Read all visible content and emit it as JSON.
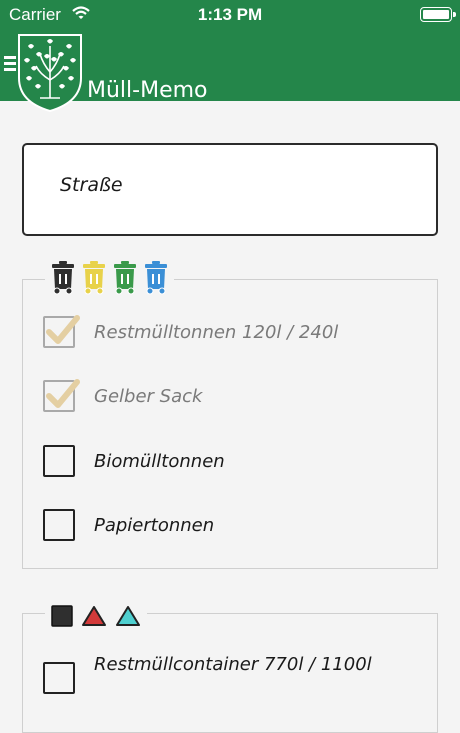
{
  "status": {
    "carrier": "Carrier",
    "time": "1:13 PM"
  },
  "header": {
    "title": "Müll-Memo"
  },
  "search": {
    "placeholder": "Straße"
  },
  "groups": [
    {
      "bin_icons": [
        "trash-bin-black-icon",
        "trash-bin-yellow-icon",
        "trash-bin-green-icon",
        "trash-bin-blue-icon"
      ],
      "items": [
        {
          "label": "Restmülltonnen 120l / 240l",
          "checked": true
        },
        {
          "label": "Gelber Sack",
          "checked": true
        },
        {
          "label": "Biomülltonnen",
          "checked": false
        },
        {
          "label": "Papiertonnen",
          "checked": false
        }
      ]
    },
    {
      "bin_icons": [
        "square-black-icon",
        "triangle-red-icon",
        "triangle-cyan-icon"
      ],
      "items": [
        {
          "label": "Restmüllcontainer 770l / 1100l",
          "checked": false
        }
      ]
    }
  ],
  "colors": {
    "brand": "#24864a",
    "bin_black": "#2f2f2f",
    "bin_yellow": "#e8d24a",
    "bin_green": "#3a9a4a",
    "bin_blue": "#3b8fd6",
    "triangle_red": "#d33a3a",
    "triangle_cyan": "#4fd0d0",
    "check_tan": "#e4cfa2"
  }
}
